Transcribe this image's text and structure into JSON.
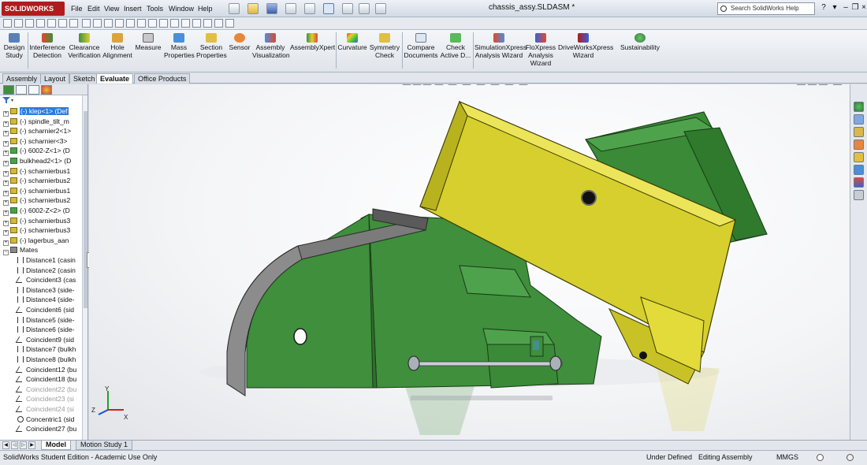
{
  "app": {
    "logo_text": "SOLIDWORKS",
    "document_title": "chassis_assy.SLDASM *",
    "menu": [
      "File",
      "Edit",
      "View",
      "Insert",
      "Tools",
      "Window",
      "Help"
    ],
    "search_placeholder": "Search SolidWorks Help"
  },
  "command_manager": {
    "items": [
      {
        "label1": "Design",
        "label2": "Study"
      },
      {
        "label1": "Interference",
        "label2": "Detection"
      },
      {
        "label1": "Clearance",
        "label2": "Verification"
      },
      {
        "label1": "Hole",
        "label2": "Alignment"
      },
      {
        "label1": "Measure",
        "label2": ""
      },
      {
        "label1": "Mass",
        "label2": "Properties"
      },
      {
        "label1": "Section",
        "label2": "Properties"
      },
      {
        "label1": "Sensor",
        "label2": ""
      },
      {
        "label1": "Assembly",
        "label2": "Visualization"
      },
      {
        "label1": "AssemblyXpert",
        "label2": ""
      },
      {
        "label1": "Curvature",
        "label2": ""
      },
      {
        "label1": "Symmetry",
        "label2": "Check"
      },
      {
        "label1": "Compare",
        "label2": "Documents"
      },
      {
        "label1": "Check",
        "label2": "Active D..."
      },
      {
        "label1": "SimulationXpress",
        "label2": "Analysis Wizard"
      },
      {
        "label1": "FloXpress",
        "label2": "Analysis",
        "label3": "Wizard"
      },
      {
        "label1": "DriveWorksXpress",
        "label2": "Wizard"
      },
      {
        "label1": "Sustainability",
        "label2": ""
      }
    ],
    "tabs": [
      "Assembly",
      "Layout",
      "Sketch",
      "Evaluate",
      "Office Products"
    ],
    "active_tab": "Evaluate"
  },
  "feature_tree": {
    "components": [
      {
        "label": "(-) klep<1> (Def",
        "selected": true,
        "color": "yellow"
      },
      {
        "label": "(-) spindle_tilt_m",
        "color": "yellow"
      },
      {
        "label": "(-) scharnier2<1>",
        "color": "yellow"
      },
      {
        "label": "(-) scharnier<3>",
        "color": "yellow"
      },
      {
        "label": "(-) 6002-Z<1> (D",
        "color": "green"
      },
      {
        "label": "bulkhead2<1> (D",
        "color": "green"
      },
      {
        "label": "(-) scharnierbus1",
        "color": "yellow"
      },
      {
        "label": "(-) scharnierbus2",
        "color": "yellow"
      },
      {
        "label": "(-) scharnierbus1",
        "color": "yellow"
      },
      {
        "label": "(-) scharnierbus2",
        "color": "yellow"
      },
      {
        "label": "(-) 6002-Z<2> (D",
        "color": "green"
      },
      {
        "label": "(-) scharnierbus3",
        "color": "yellow"
      },
      {
        "label": "(-) scharnierbus3",
        "color": "yellow"
      },
      {
        "label": "(-) lagerbus_aan",
        "color": "yellow"
      }
    ],
    "mates_label": "Mates",
    "mates": [
      {
        "label": "Distance1 (casin",
        "type": "dist"
      },
      {
        "label": "Distance2 (casin",
        "type": "dist"
      },
      {
        "label": "Coincident3 (cas",
        "type": "coin"
      },
      {
        "label": "Distance3 (side-",
        "type": "dist"
      },
      {
        "label": "Distance4 (side-",
        "type": "dist"
      },
      {
        "label": "Coincident6 (sid",
        "type": "coin"
      },
      {
        "label": "Distance5 (side-",
        "type": "dist"
      },
      {
        "label": "Distance6 (side-",
        "type": "dist"
      },
      {
        "label": "Coincident9 (sid",
        "type": "coin"
      },
      {
        "label": "Distance7 (bulkh",
        "type": "dist"
      },
      {
        "label": "Distance8 (bulkh",
        "type": "dist"
      },
      {
        "label": "Coincident12 (bu",
        "type": "coin"
      },
      {
        "label": "Coincident18 (bu",
        "type": "coin"
      },
      {
        "label": "Coincident22 (bu",
        "type": "coin",
        "dim": true
      },
      {
        "label": "Coincident23 (si",
        "type": "coin",
        "dim": true
      },
      {
        "label": "Coincident24 (si",
        "type": "coin",
        "dim": true
      },
      {
        "label": "Concentric1 (sid",
        "type": "conc"
      },
      {
        "label": "Coincident27 (bu",
        "type": "coin"
      }
    ]
  },
  "bottom_tabs": [
    "Model",
    "Motion Study 1"
  ],
  "active_bottom_tab": "Model",
  "status": {
    "left": "SolidWorks Student Edition - Academic Use Only",
    "state": "Under Defined",
    "mode": "Editing Assembly",
    "units": "MMGS"
  },
  "triad": {
    "x": "X",
    "y": "Y",
    "z": "Z"
  },
  "colors": {
    "green_part": "#3f8f3c",
    "yellow_part": "#d6cf2e",
    "grey_part": "#7b7b7b",
    "selection": "#2f7bdc"
  }
}
